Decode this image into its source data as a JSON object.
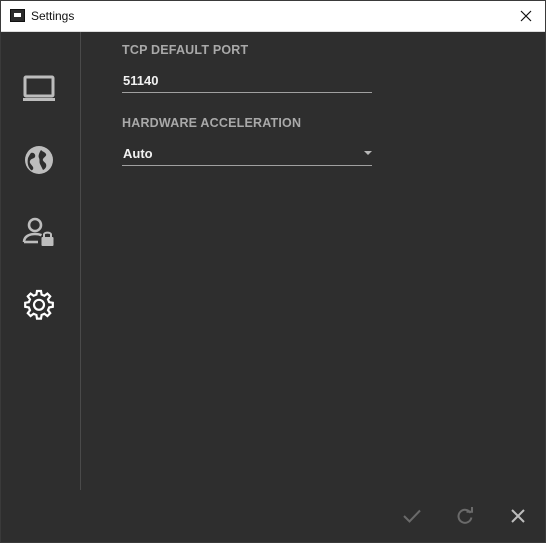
{
  "window": {
    "title": "Settings"
  },
  "sidebar": {
    "items": [
      {
        "icon": "monitor-icon"
      },
      {
        "icon": "globe-icon"
      },
      {
        "icon": "user-lock-icon"
      },
      {
        "icon": "gear-icon",
        "selected": true
      }
    ]
  },
  "settings": {
    "tcp_port": {
      "label": "TCP DEFAULT PORT",
      "value": "51140"
    },
    "hardware_acceleration": {
      "label": "HARDWARE ACCELERATION",
      "value": "Auto"
    }
  },
  "footer": {
    "confirm_icon": "check-icon",
    "reset_icon": "refresh-icon",
    "cancel_icon": "close-icon"
  },
  "colors": {
    "background": "#2e2e2e",
    "label": "#a9a9a9",
    "value": "#f2f2f2",
    "icon": "#bdbdbd",
    "footer_icon": "#6a6a6a"
  }
}
